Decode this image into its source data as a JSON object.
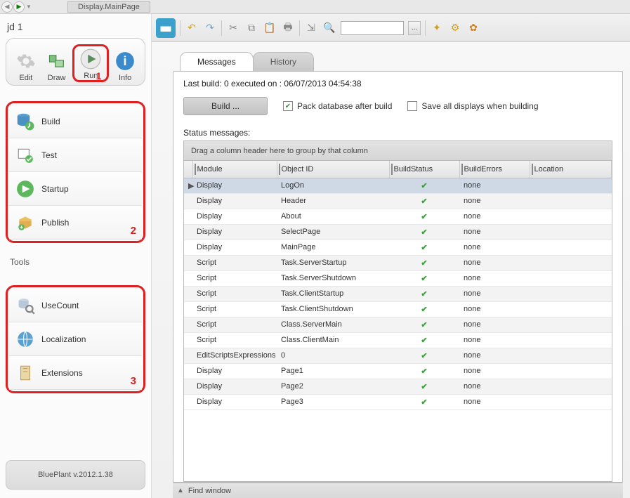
{
  "topbar": {
    "breadcrumb": "Display.MainPage"
  },
  "project": {
    "title": "jd 1"
  },
  "toolbtns": {
    "edit": "Edit",
    "draw": "Draw",
    "run": "Run",
    "info": "Info"
  },
  "annotations": {
    "n1": "1",
    "n2": "2",
    "n3": "3"
  },
  "nav1": {
    "build": "Build",
    "test": "Test",
    "startup": "Startup",
    "publish": "Publish"
  },
  "tools_label": "Tools",
  "nav2": {
    "usecount": "UseCount",
    "localization": "Localization",
    "extensions": "Extensions"
  },
  "version": "BluePlant  v.2012.1.38",
  "tabs": {
    "messages": "Messages",
    "history": "History"
  },
  "lastbuild": "Last build:  0    executed on : 06/07/2013 04:54:38",
  "buildbtn": "Build ...",
  "chk_pack": "Pack database after build",
  "chk_save": "Save all displays when building",
  "statuslbl": "Status messages:",
  "groupbar": "Drag a column header here to group by that column",
  "cols": {
    "module": "Module",
    "objid": "Object ID",
    "bstatus": "BuildStatus",
    "berrors": "BuildErrors",
    "loc": "Location"
  },
  "rows": [
    {
      "module": "Display",
      "obj": "LogOn",
      "err": "none",
      "sel": true
    },
    {
      "module": "Display",
      "obj": "Header",
      "err": "none"
    },
    {
      "module": "Display",
      "obj": "About",
      "err": "none"
    },
    {
      "module": "Display",
      "obj": "SelectPage",
      "err": "none"
    },
    {
      "module": "Display",
      "obj": "MainPage",
      "err": "none"
    },
    {
      "module": "Script",
      "obj": "Task.ServerStartup",
      "err": "none"
    },
    {
      "module": "Script",
      "obj": "Task.ServerShutdown",
      "err": "none"
    },
    {
      "module": "Script",
      "obj": "Task.ClientStartup",
      "err": "none"
    },
    {
      "module": "Script",
      "obj": "Task.ClientShutdown",
      "err": "none"
    },
    {
      "module": "Script",
      "obj": "Class.ServerMain",
      "err": "none"
    },
    {
      "module": "Script",
      "obj": "Class.ClientMain",
      "err": "none"
    },
    {
      "module": "EditScriptsExpressions",
      "obj": "0",
      "err": "none"
    },
    {
      "module": "Display",
      "obj": "Page1",
      "err": "none"
    },
    {
      "module": "Display",
      "obj": "Page2",
      "err": "none"
    },
    {
      "module": "Display",
      "obj": "Page3",
      "err": "none"
    }
  ],
  "findwindow": "Find window"
}
